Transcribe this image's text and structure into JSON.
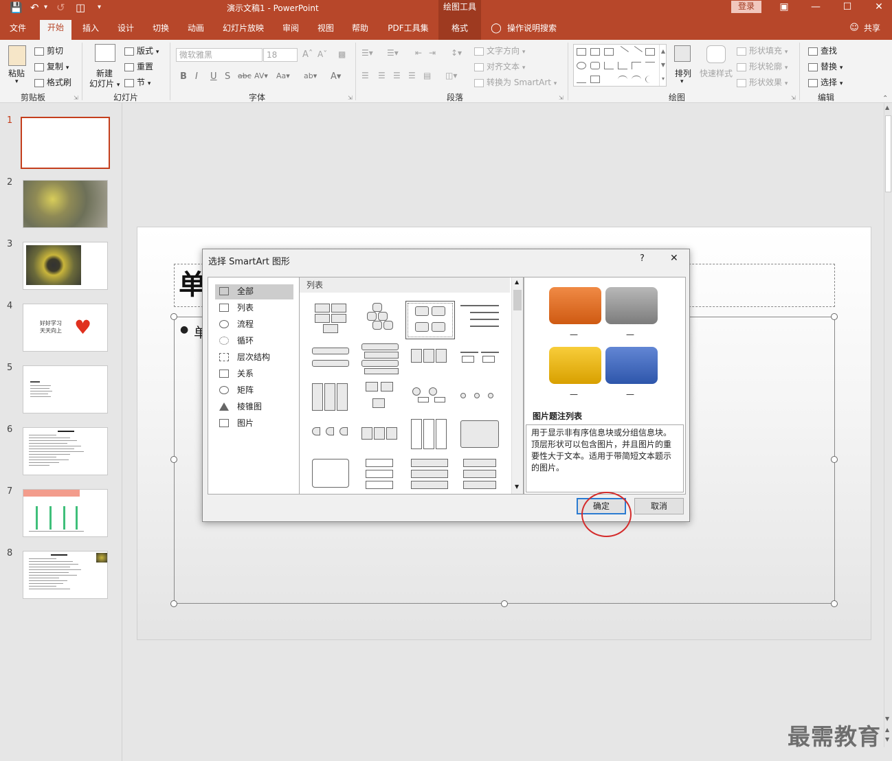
{
  "window": {
    "title": "演示文稿1  -  PowerPoint",
    "context_tab_group": "绘图工具",
    "login_label": "登录"
  },
  "tabs": [
    "文件",
    "开始",
    "插入",
    "设计",
    "切换",
    "动画",
    "幻灯片放映",
    "审阅",
    "视图",
    "帮助",
    "PDF工具集",
    "格式"
  ],
  "tell_me": "操作说明搜索",
  "share": "共享",
  "ribbon": {
    "clipboard": {
      "paste": "粘贴",
      "cut": "剪切",
      "copy": "复制",
      "format_painter": "格式刷",
      "label": "剪贴板"
    },
    "slides": {
      "new_slide": "新建",
      "new_slide2": "幻灯片",
      "layout": "版式",
      "reset": "重置",
      "section": "节",
      "label": "幻灯片"
    },
    "font": {
      "font_name": "微软雅黑",
      "font_size": "18",
      "label": "字体"
    },
    "paragraph": {
      "text_direction": "文字方向",
      "align_text": "对齐文本",
      "convert_smartart": "转换为 SmartArt",
      "label": "段落"
    },
    "drawing": {
      "arrange": "排列",
      "quick_styles": "快速样式",
      "shape_fill": "形状填充",
      "shape_outline": "形状轮廓",
      "shape_effects": "形状效果",
      "label": "绘图"
    },
    "editing": {
      "find": "查找",
      "replace": "替换",
      "select": "选择",
      "label": "编辑"
    }
  },
  "slides": [
    {
      "num": "1"
    },
    {
      "num": "2"
    },
    {
      "num": "3"
    },
    {
      "num": "4",
      "text1": "好好学习",
      "text2": "天天向上"
    },
    {
      "num": "5"
    },
    {
      "num": "6"
    },
    {
      "num": "7"
    },
    {
      "num": "8"
    }
  ],
  "slide_title_char": "单",
  "slide_bullet_char": "单",
  "dialog": {
    "title": "选择 SmartArt 图形",
    "help": "?",
    "close": "✕",
    "categories": [
      "全部",
      "列表",
      "流程",
      "循环",
      "层次结构",
      "关系",
      "矩阵",
      "棱锥图",
      "图片"
    ],
    "gallery_header": "列表",
    "preview_name": "图片题注列表",
    "preview_desc": "用于显示非有序信息块或分组信息块。顶层形状可以包含图片，并且图片的重要性大于文本。适用于带简短文本题示的图片。",
    "preview_dash": "—",
    "ok": "确定",
    "cancel": "取消"
  },
  "colors": {
    "accent": "#b7472a",
    "orange": "#e06a1c",
    "gray": "#8c8c8c",
    "gold": "#e8b10a",
    "blue": "#3f6bc4"
  },
  "watermark": "最需教育"
}
